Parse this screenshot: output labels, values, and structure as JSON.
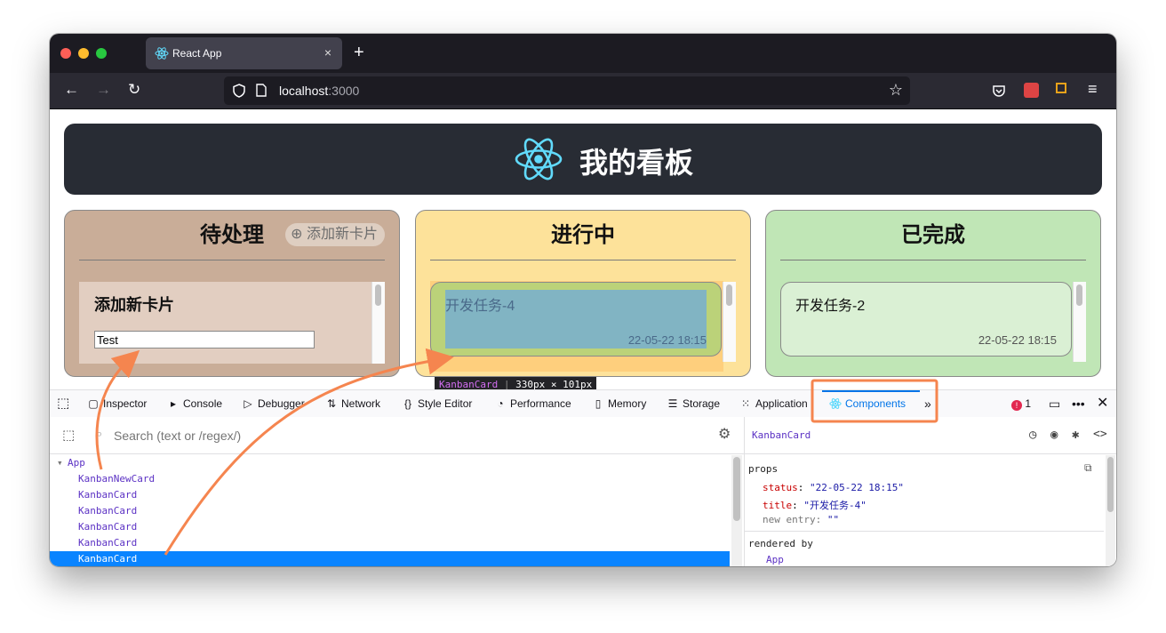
{
  "browser": {
    "tab_title": "React App",
    "tab_close": "×",
    "new_tab": "+",
    "url_host": "localhost",
    "url_port": ":3000"
  },
  "page": {
    "header_title": "我的看板",
    "columns": [
      {
        "title": "待处理",
        "add_button": "添加新卡片",
        "bg": "#c9ad98",
        "card_title": "添加新卡片",
        "input_value": "Test"
      },
      {
        "title": "进行中",
        "bg": "#fde29a",
        "card_title": "开发任务-4",
        "card_status": "22-05-22 18:15"
      },
      {
        "title": "已完成",
        "bg": "#c0e6b6",
        "card_title": "开发任务-2",
        "card_status": "22-05-22 18:15"
      }
    ]
  },
  "devtools": {
    "highlight_tooltip": {
      "name": "KanbanCard",
      "size": "330px × 101px"
    },
    "tabs": [
      "Inspector",
      "Console",
      "Debugger",
      "Network",
      "Style Editor",
      "Performance",
      "Memory",
      "Storage",
      "Application",
      "Components"
    ],
    "active_tab": "Components",
    "error_count": "1",
    "search_placeholder": "Search (text or /regex/)",
    "tree": [
      {
        "label": "App",
        "depth": 0,
        "expanded": true
      },
      {
        "label": "KanbanNewCard",
        "depth": 1
      },
      {
        "label": "KanbanCard",
        "depth": 1
      },
      {
        "label": "KanbanCard",
        "depth": 1
      },
      {
        "label": "KanbanCard",
        "depth": 1
      },
      {
        "label": "KanbanCard",
        "depth": 1
      },
      {
        "label": "KanbanCard",
        "depth": 1,
        "selected": true
      }
    ],
    "selected_component": "KanbanCard",
    "props_heading": "props",
    "props": [
      {
        "key": "status",
        "value": "\"22-05-22 18:15\""
      },
      {
        "key": "title",
        "value": "\"开发任务-4\""
      },
      {
        "key": "new entry",
        "value": "\"\""
      }
    ],
    "rendered_by_heading": "rendered by",
    "rendered_by": "App"
  },
  "colors": {
    "accent": "#0074e8",
    "annotation": "#f5854f",
    "selection": "#0a84ff"
  }
}
